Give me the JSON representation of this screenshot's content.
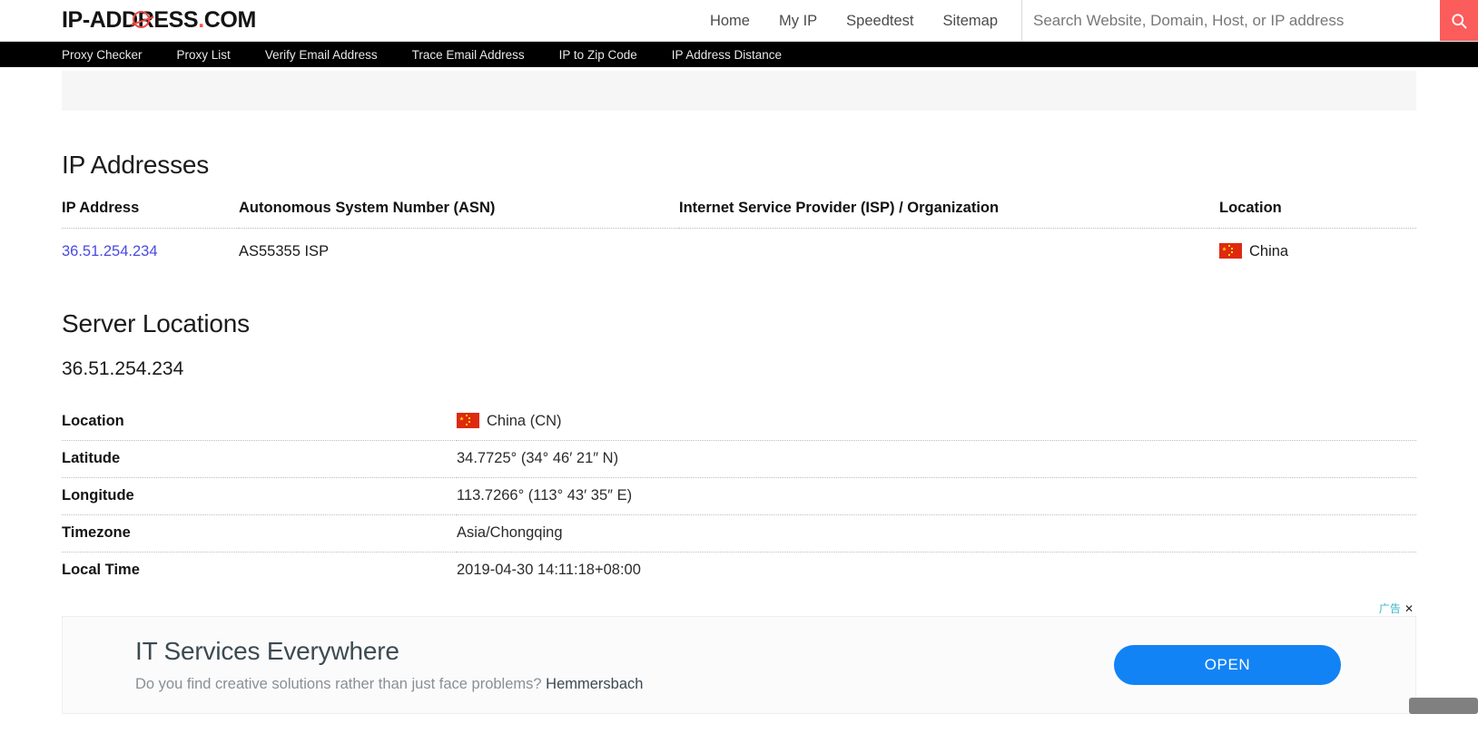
{
  "header": {
    "logo_text_1": "IP-A",
    "logo_text_2": "DDRESS",
    "logo_dot": ".",
    "logo_text_3": "COM",
    "nav": [
      {
        "label": "Home"
      },
      {
        "label": "My IP"
      },
      {
        "label": "Speedtest"
      },
      {
        "label": "Sitemap"
      }
    ],
    "search": {
      "placeholder": "Search Website, Domain, Host, or IP address",
      "value": "",
      "icon": "search-icon",
      "button_color": "#fb5c5c"
    }
  },
  "subnav": {
    "items": [
      {
        "label": "Proxy Checker"
      },
      {
        "label": "Proxy List"
      },
      {
        "label": "Verify Email Address"
      },
      {
        "label": "Trace Email Address"
      },
      {
        "label": "IP to Zip Code"
      },
      {
        "label": "IP Address Distance"
      }
    ]
  },
  "ip_addresses": {
    "heading": "IP Addresses",
    "columns": [
      "IP Address",
      "Autonomous System Number (ASN)",
      "Internet Service Provider (ISP) / Organization",
      "Location"
    ],
    "rows": [
      {
        "ip": "36.51.254.234",
        "asn": "AS55355 ISP",
        "isp": "",
        "location": "China",
        "flag": "cn-flag-icon"
      }
    ],
    "link_color": "#4a4ae0"
  },
  "server_locations": {
    "heading": "Server Locations",
    "ip": "36.51.254.234",
    "rows": [
      {
        "label": "Location",
        "value": "China (CN)",
        "flag": "cn-flag-icon"
      },
      {
        "label": "Latitude",
        "value": "34.7725° (34° 46′ 21″ N)",
        "flag": ""
      },
      {
        "label": "Longitude",
        "value": "113.7266° (113° 43′ 35″ E)",
        "flag": ""
      },
      {
        "label": "Timezone",
        "value": "Asia/Chongqing",
        "flag": ""
      },
      {
        "label": "Local Time",
        "value": "2019-04-30 14:11:18+08:00",
        "flag": ""
      }
    ]
  },
  "advertisement": {
    "label": "广告",
    "close": "✕",
    "headline": "IT Services Everywhere",
    "subline": "Do you find creative solutions rather than just face problems? ",
    "brand": "Hemmersbach",
    "button_label": "OPEN",
    "button_color": "#1283f5"
  }
}
